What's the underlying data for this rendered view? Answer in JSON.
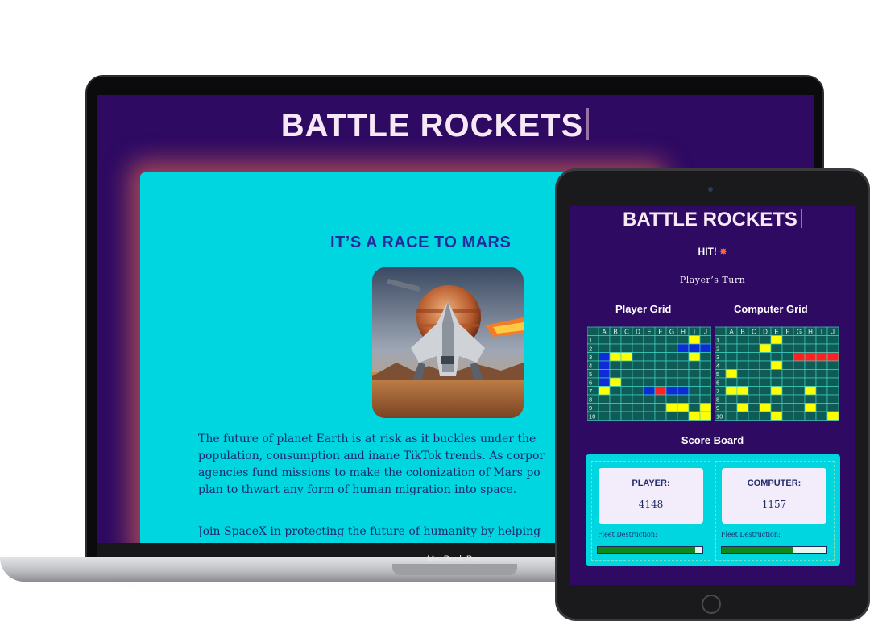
{
  "laptop": {
    "title": "BATTLE ROCKETS",
    "heading": "IT'S A RACE TO MARS",
    "paragraph_lines": [
      "The future of planet Earth is at risk as it buckles under the",
      "population, consumption and inane TikTok trends. As corpor",
      "agencies fund missions to make the colonization of Mars po",
      "plan to thwart any form of human migration into space."
    ],
    "paragraph2": "Join SpaceX in protecting the future of humanity by helping",
    "device_label": "MacBook Pro"
  },
  "tablet": {
    "title": "BATTLE ROCKETS",
    "hit": "HIT!",
    "hit_icon": "explosion-icon",
    "turn": "Player's Turn",
    "player_grid_label": "Player Grid",
    "computer_grid_label": "Computer Grid",
    "columns": [
      "A",
      "B",
      "C",
      "D",
      "E",
      "F",
      "G",
      "H",
      "I",
      "J"
    ],
    "rows": [
      "1",
      "2",
      "3",
      "4",
      "5",
      "6",
      "7",
      "8",
      "9",
      "10"
    ],
    "scoreboard_label": "Score Board",
    "player": {
      "name": "PLAYER:",
      "score": "4148",
      "fleet_label": "Fleet Destruction:",
      "fleet_pct": 0.93
    },
    "computer": {
      "name": "COMPUTER:",
      "score": "1157",
      "fleet_label": "Fleet Destruction:",
      "fleet_pct": 0.68
    }
  },
  "colors": {
    "background": "#2e0a63",
    "card": "#00d6e0",
    "cell": "#0f5b55",
    "miss": "#ffff00",
    "ship": "#0f2bd6",
    "hit": "#ff2020"
  },
  "player_grid": [
    "........Y.",
    ".......BBBB",
    "BYY.....Y.",
    "B.........",
    "B.........",
    "BY........",
    "Y...BRBB..",
    "..........",
    "......YY.Y",
    "........YY"
  ],
  "computer_grid": [
    "....Y.....",
    "...Y......",
    "......RRRR",
    "....Y.....",
    "Y.........",
    "..........",
    "YY..Y..Y..",
    "..........",
    ".Y.Y...Y..",
    "....Y....Y"
  ]
}
